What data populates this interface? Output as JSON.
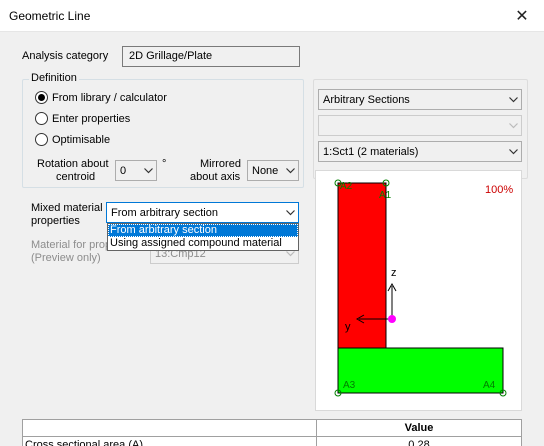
{
  "window": {
    "title": "Geometric Line"
  },
  "analysis": {
    "label": "Analysis category",
    "value": "2D Grillage/Plate"
  },
  "definition": {
    "legend": "Definition",
    "options": [
      {
        "label": "From library / calculator",
        "selected": true
      },
      {
        "label": "Enter properties",
        "selected": false
      },
      {
        "label": "Optimisable",
        "selected": false
      }
    ],
    "rotation_label_1": "Rotation about",
    "rotation_label_2": "centroid",
    "rotation_value": "0",
    "degree_symbol": "°",
    "mirrored_label_1": "Mirrored",
    "mirrored_label_2": "about axis",
    "mirrored_value": "None"
  },
  "mixed": {
    "label_1": "Mixed material",
    "label_2": "properties",
    "value": "From arbitrary section",
    "options": [
      {
        "label": "From arbitrary section",
        "selected": true
      },
      {
        "label": "Using assigned compound material",
        "selected": false
      }
    ]
  },
  "material_for_props": {
    "label_1": "Material for prop",
    "label_2": "(Preview only)",
    "value": "13:Cmp12"
  },
  "section": {
    "type_value": "Arbitrary Sections",
    "subtype_value": "",
    "section_value": "1:Sct1 (2 materials)"
  },
  "preview": {
    "percent": "100%",
    "corner_labels": [
      "A2",
      "A1",
      "A3",
      "A4"
    ],
    "axis_z": "z",
    "axis_y": "y",
    "colors": {
      "top_flange": "#ff0000",
      "bottom_flange": "#00ff00",
      "centroid": "#ff00ff",
      "percent": "#cc0000",
      "vertex": "#008000"
    }
  },
  "properties_table": {
    "headers": [
      "",
      "Value"
    ],
    "rows": [
      {
        "name": "Cross sectional area (A)",
        "value": "0.28"
      }
    ]
  }
}
